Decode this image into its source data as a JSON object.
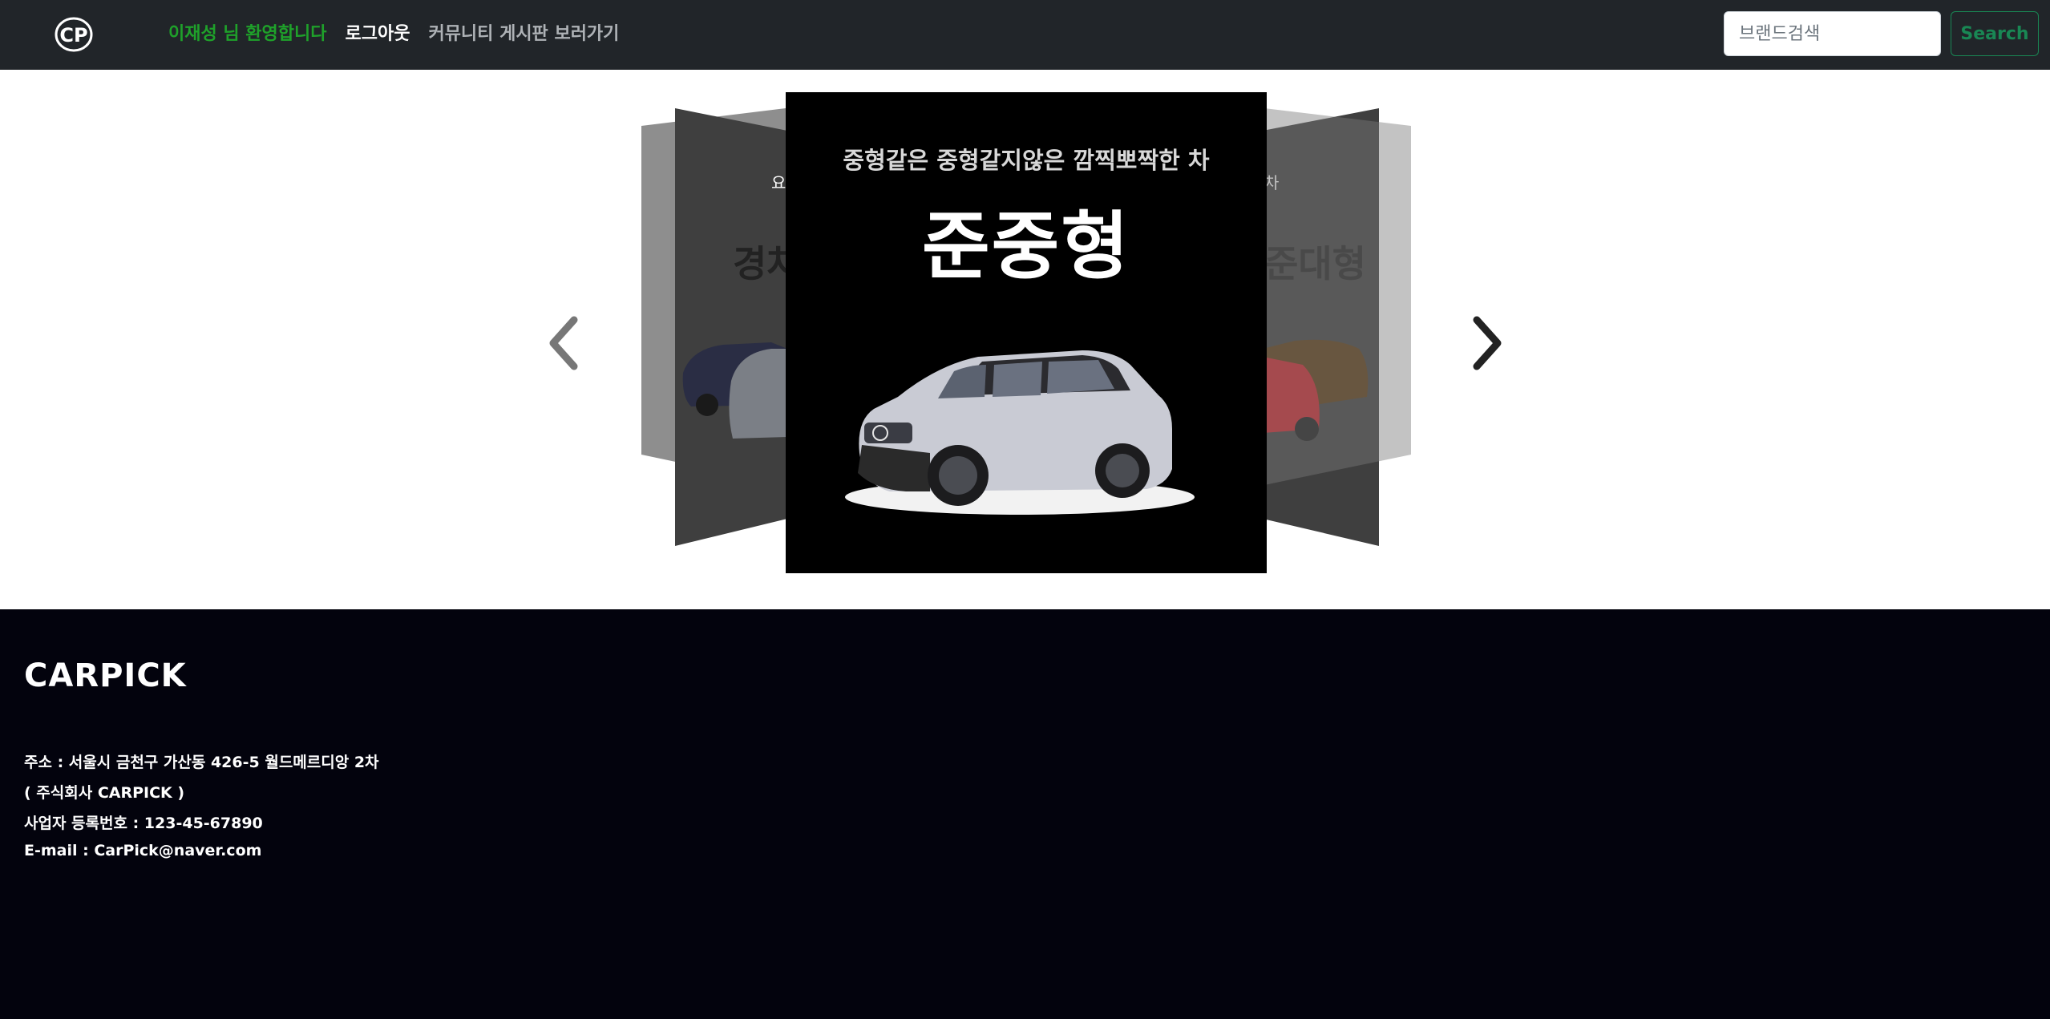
{
  "nav": {
    "welcome": "이재성 님 환영합니다",
    "logout": "로그아웃",
    "community": "커뮤니티 게시판 보러가기",
    "search_placeholder": "브랜드검색",
    "search_button": "Search",
    "logo_text": "CP"
  },
  "carousel": {
    "active_card": {
      "subtitle": "중형같은 중형같지않은 깜찍뽀짝한 차",
      "title": "준중형"
    },
    "left_card": {
      "subtitle_fragment": "요",
      "title_fragment": "경차"
    },
    "right_card": {
      "subtitle_fragment": "차",
      "title_fragment": "준대형"
    },
    "prev_icon": "chevron-left-icon",
    "next_icon": "chevron-right-icon"
  },
  "footer": {
    "brand": "CARPICK",
    "address": "주소 : 서울시 금천구 가산동 426-5 월드메르디앙 2차",
    "company": "( 주식회사 CARPICK )",
    "business_no": "사업자 등록번호 : 123-45-67890",
    "email": "E-mail : CarPick@naver.com"
  },
  "colors": {
    "navbar_bg": "#212529",
    "welcome": "#1fa12a",
    "search_button": "#198754",
    "footer_bg": "#03030d"
  }
}
